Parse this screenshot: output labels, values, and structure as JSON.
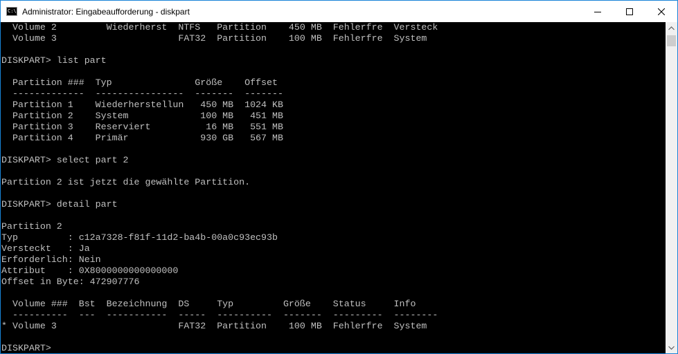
{
  "window": {
    "title": "Administrator: Eingabeaufforderung - diskpart",
    "app_icon": "cmd-icon",
    "app_icon_glyph": "C:\\",
    "controls": [
      "minimize-icon",
      "maximize-icon",
      "close-icon"
    ]
  },
  "console": {
    "lines": [
      "  Volume 2         Wiederherst  NTFS   Partition    450 MB  Fehlerfre  Versteck",
      "  Volume 3                      FAT32  Partition    100 MB  Fehlerfre  System",
      "",
      "DISKPART> list part",
      "",
      "  Partition ###  Typ               Größe    Offset",
      "  -------------  ----------------  -------  -------",
      "  Partition 1    Wiederherstellun   450 MB  1024 KB",
      "  Partition 2    System             100 MB   451 MB",
      "  Partition 3    Reserviert          16 MB   551 MB",
      "  Partition 4    Primär             930 GB   567 MB",
      "",
      "DISKPART> select part 2",
      "",
      "Partition 2 ist jetzt die gewählte Partition.",
      "",
      "DISKPART> detail part",
      "",
      "Partition 2",
      "Typ         : c12a7328-f81f-11d2-ba4b-00a0c93ec93b",
      "Versteckt   : Ja",
      "Erforderlich: Nein",
      "Attribut    : 0X8000000000000000",
      "Offset in Byte: 472907776",
      "",
      "  Volume ###  Bst  Bezeichnung  DS     Typ         Größe    Status     Info",
      "  ----------  ---  -----------  -----  ----------  -------  ---------  --------",
      "* Volume 3                      FAT32  Partition    100 MB  Fehlerfre  System",
      "",
      "DISKPART> "
    ]
  },
  "scrollbar": {
    "up_icon": "scroll-up-arrow-icon",
    "down_icon": "scroll-down-arrow-icon"
  }
}
